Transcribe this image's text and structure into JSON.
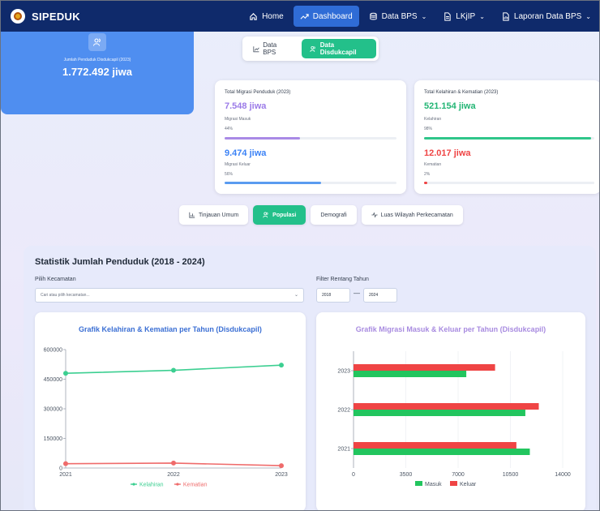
{
  "app": {
    "name": "SIPEDUK"
  },
  "nav": [
    {
      "label": "Home",
      "icon": "home-icon",
      "active": false,
      "dropdown": false
    },
    {
      "label": "Dashboard",
      "icon": "trend-icon",
      "active": true,
      "dropdown": false
    },
    {
      "label": "Data BPS",
      "icon": "database-icon",
      "active": false,
      "dropdown": true
    },
    {
      "label": "LKjIP",
      "icon": "document-icon",
      "active": false,
      "dropdown": true
    },
    {
      "label": "Laporan Data BPS",
      "icon": "report-icon",
      "active": false,
      "dropdown": true
    }
  ],
  "source_toggle": {
    "bps": "Data BPS",
    "dukcapil": "Data Disdukcapil"
  },
  "summary": {
    "total": {
      "label": "Jumlah Penduduk Disdukcapil (2023)",
      "value": "1.772.492 jiwa"
    },
    "migrasi": {
      "title": "Total Migrasi Penduduk (2023)",
      "masuk_value": "7.548 jiwa",
      "masuk_label": "Migrasi Masuk",
      "masuk_pct": "44%",
      "masuk_fill": 0.44,
      "keluar_value": "9.474 jiwa",
      "keluar_label": "Migrasi Keluar",
      "keluar_pct": "56%",
      "keluar_fill": 0.56
    },
    "lahir": {
      "title": "Total Kelahiran & Kematian (2023)",
      "lahir_value": "521.154 jiwa",
      "lahir_label": "Kelahiran",
      "lahir_pct": "98%",
      "lahir_fill": 0.98,
      "mati_value": "12.017 jiwa",
      "mati_label": "Kematian",
      "mati_pct": "2%",
      "mati_fill": 0.02
    }
  },
  "tabs": [
    {
      "label": "Tinjauan Umum",
      "icon": "chart-icon",
      "active": false
    },
    {
      "label": "Populasi",
      "icon": "users-icon",
      "active": true
    },
    {
      "label": "Demografi",
      "icon": "",
      "active": false
    },
    {
      "label": "Luas Wilayah Perkecamatan",
      "icon": "pulse-icon",
      "active": false
    }
  ],
  "stats": {
    "title": "Statistik Jumlah Penduduk (2018 - 2024)",
    "kecamatan_label": "Pilih Kecamatan",
    "kecamatan_placeholder": "Cari atau pilih kecamatan...",
    "filter_label": "Filter Rentang Tahun",
    "year_from": "2018",
    "year_to": "2024",
    "separator": "—"
  },
  "chart_data": [
    {
      "type": "line",
      "title": "Grafik Kelahiran & Kematian per Tahun (Disdukcapil)",
      "x": [
        "2021",
        "2022",
        "2023"
      ],
      "yticks": [
        "0",
        "150000",
        "300000",
        "450000",
        "600000"
      ],
      "ylim": [
        0,
        600000
      ],
      "series": [
        {
          "name": "Kelahiran",
          "color": "#3ccf91",
          "values": [
            480000,
            495000,
            521154
          ]
        },
        {
          "name": "Kematian",
          "color": "#ef6b6b",
          "values": [
            22000,
            25000,
            12017
          ]
        }
      ],
      "legend": "bottom"
    },
    {
      "type": "bar",
      "orientation": "horizontal",
      "title": "Grafik Migrasi Masuk & Keluar per Tahun (Disdukcapil)",
      "categories": [
        "2023",
        "2022",
        "2021"
      ],
      "xticks": [
        "0",
        "3500",
        "7000",
        "10500",
        "14000"
      ],
      "xlim": [
        0,
        14000
      ],
      "series": [
        {
          "name": "Masuk",
          "color": "#22c55e",
          "values": [
            7548,
            11500,
            11800
          ]
        },
        {
          "name": "Keluar",
          "color": "#ef4444",
          "values": [
            9474,
            12400,
            10900
          ]
        }
      ],
      "legend": "bottom"
    }
  ]
}
